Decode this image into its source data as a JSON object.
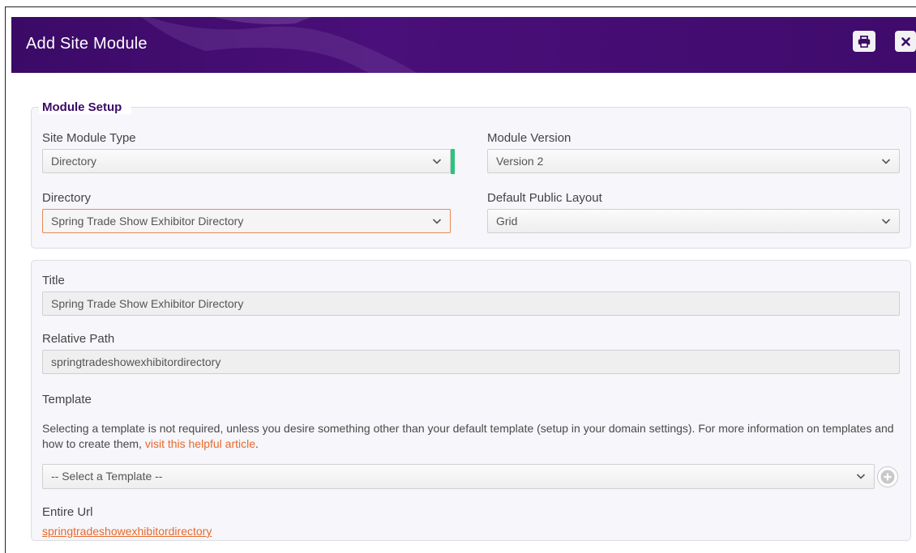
{
  "dialog": {
    "title": "Add Site Module",
    "accent_color": "#3b0a66",
    "print_icon": "print-icon",
    "close_icon": "close-icon"
  },
  "setup": {
    "legend": "Module Setup",
    "site_module_type": {
      "label": "Site Module Type",
      "value": "Directory"
    },
    "module_version": {
      "label": "Module Version",
      "value": "Version 2"
    },
    "directory": {
      "label": "Directory",
      "value": "Spring Trade Show Exhibitor Directory"
    },
    "default_public_layout": {
      "label": "Default Public Layout",
      "value": "Grid"
    }
  },
  "details": {
    "title": {
      "label": "Title",
      "value": "Spring Trade Show Exhibitor Directory"
    },
    "relative_path": {
      "label": "Relative Path",
      "value": "springtradeshowexhibitordirectory"
    },
    "template": {
      "label": "Template",
      "description": "Selecting a template is not required, unless you desire something other than your default template (setup in your domain settings). For more information on templates and how to create them, ",
      "link_text": "visit this helpful article",
      "description_end": ".",
      "select_value": "-- Select a Template --",
      "link_color": "#e8692a"
    },
    "entire_url": {
      "label": "Entire Url",
      "value": "springtradeshowexhibitordirectory"
    }
  }
}
